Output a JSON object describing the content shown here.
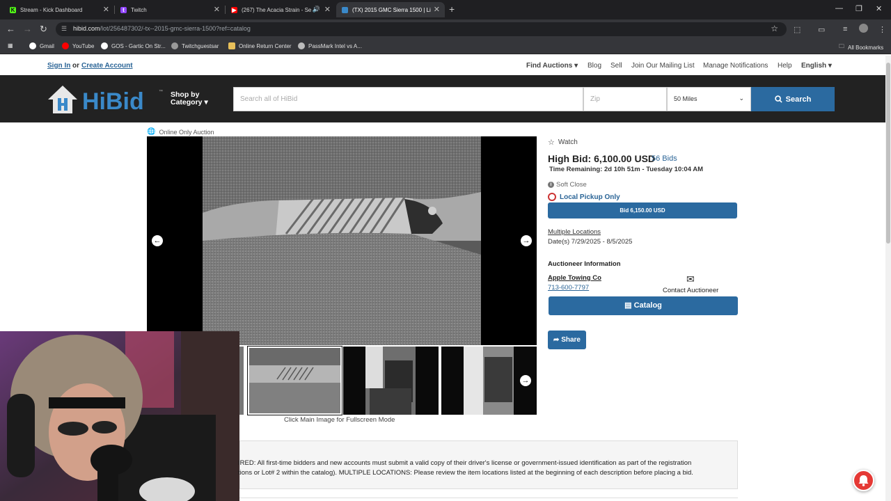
{
  "browser": {
    "tabs": [
      {
        "title": "Stream - Kick Dashboard",
        "favicon": "kick-icon"
      },
      {
        "title": "Twitch",
        "favicon": "twitch-icon"
      },
      {
        "title": "(267) The Acacia Strain - Se",
        "favicon": "youtube-icon"
      },
      {
        "title": "(TX) 2015 GMC Sierra 1500 | Li",
        "favicon": "hibid-icon"
      }
    ],
    "url_host": "hibid.com",
    "url_path": "/lot/256487302/-tx--2015-gmc-sierra-1500?ref=catalog",
    "bookmarks": [
      "Gmail",
      "YouTube",
      "GOS - Gartic On Str...",
      "Twitchguestsar",
      "Online Return Center",
      "PassMark Intel vs A..."
    ],
    "all_bookmarks": "All Bookmarks"
  },
  "topnav": {
    "sign_in": "Sign In",
    "or": "or",
    "create_account": "Create Account",
    "find_auctions": "Find Auctions",
    "blog": "Blog",
    "sell": "Sell",
    "mailing_list": "Join Our Mailing List",
    "manage_notifications": "Manage Notifications",
    "help": "Help",
    "language": "English"
  },
  "header": {
    "shop_by": "Shop by",
    "category": "Category",
    "search_placeholder": "Search all of HiBid",
    "zip_placeholder": "Zip",
    "miles": "50 Miles",
    "search_button": "Search"
  },
  "lot": {
    "auction_type": "Online Only Auction",
    "fullscreen_note": "Click Main Image for Fullscreen Mode",
    "watch": "Watch",
    "high_bid": "High Bid: 6,100.00 USD",
    "bids": "56 Bids",
    "time_remaining": "Time Remaining: 2d 10h 51m - Tuesday 10:04 AM",
    "soft_close": "Soft Close",
    "local_pickup": "Local Pickup Only",
    "bid_button": "Bid 6,150.00 USD",
    "multiple_locations": "Multiple Locations",
    "dates": "Date(s) 7/29/2025 - 8/5/2025",
    "auctioneer_heading": "Auctioneer Information",
    "auctioneer_name": "Apple Towing Co",
    "auctioneer_phone": "713-600-7797",
    "contact_auctioneer": "Contact Auctioneer",
    "catalog_button": "Catalog",
    "share_button": "Share",
    "info_line1": "IRED: All first-time bidders and new accounts must submit a valid copy of their driver's license or government-issued identification as part of the registration",
    "info_line2": "tions or Lot# 2 within the catalog). MULTIPLE LOCATIONS: Please review the item locations listed at the beginning of each description before placing a bid."
  },
  "colors": {
    "brand_blue": "#2b6aa0",
    "link_blue": "#2a6496",
    "header_dark": "#222222"
  }
}
